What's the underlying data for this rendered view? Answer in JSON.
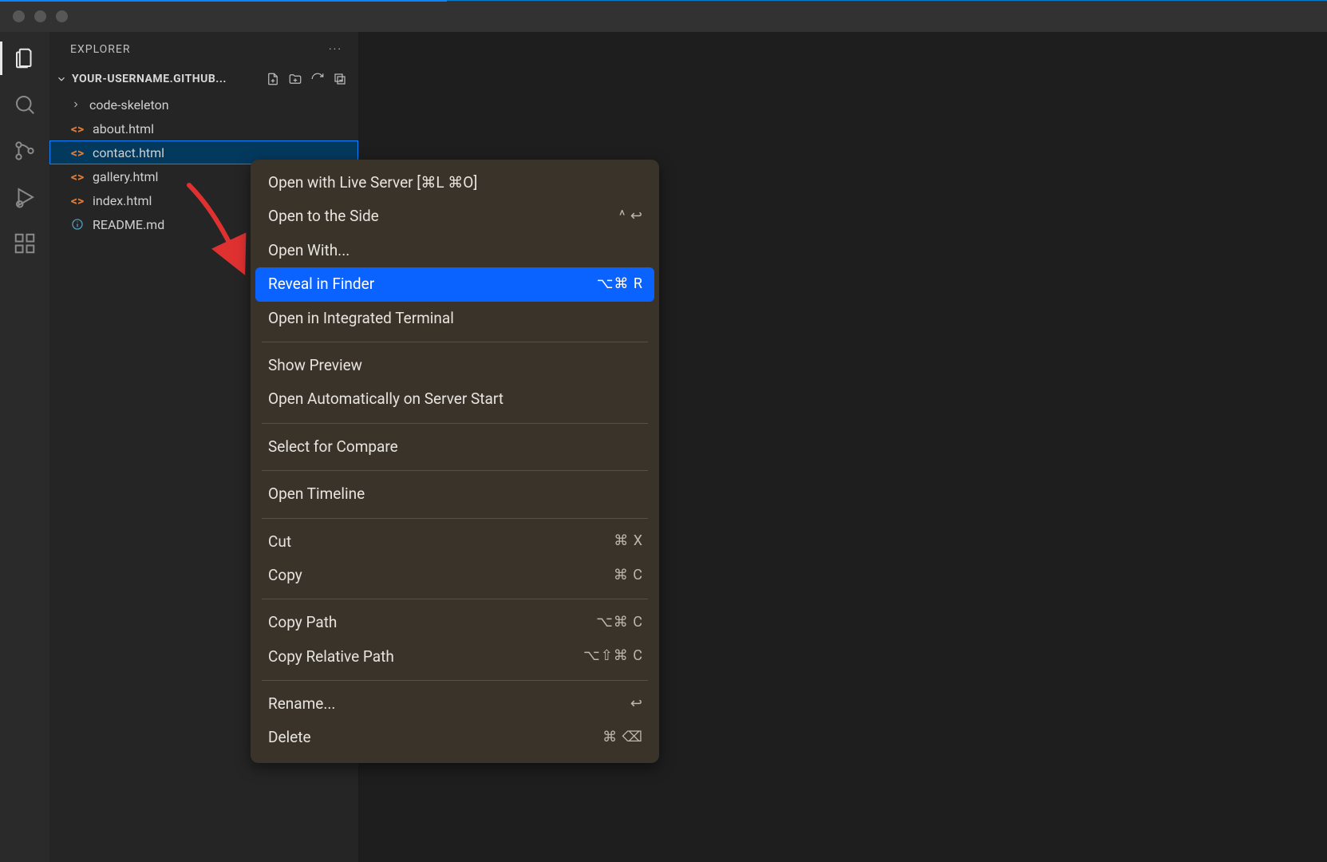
{
  "sidebar": {
    "title": "EXPLORER",
    "folder_name": "YOUR-USERNAME.GITHUB...",
    "items": [
      {
        "type": "folder",
        "name": "code-skeleton"
      },
      {
        "type": "file",
        "icon": "html",
        "name": "about.html"
      },
      {
        "type": "file",
        "icon": "html",
        "name": "contact.html",
        "selected": true
      },
      {
        "type": "file",
        "icon": "html",
        "name": "gallery.html"
      },
      {
        "type": "file",
        "icon": "html",
        "name": "index.html"
      },
      {
        "type": "file",
        "icon": "md",
        "name": "README.md"
      }
    ]
  },
  "context_menu": {
    "groups": [
      [
        {
          "label": "Open with Live Server [⌘L ⌘O]",
          "shortcut": ""
        },
        {
          "label": "Open to the Side",
          "shortcut": "^ ↩"
        },
        {
          "label": "Open With...",
          "shortcut": ""
        },
        {
          "label": "Reveal in Finder",
          "shortcut": "⌥⌘ R",
          "highlight": true
        },
        {
          "label": "Open in Integrated Terminal",
          "shortcut": ""
        }
      ],
      [
        {
          "label": "Show Preview",
          "shortcut": ""
        },
        {
          "label": "Open Automatically on Server Start",
          "shortcut": ""
        }
      ],
      [
        {
          "label": "Select for Compare",
          "shortcut": ""
        }
      ],
      [
        {
          "label": "Open Timeline",
          "shortcut": ""
        }
      ],
      [
        {
          "label": "Cut",
          "shortcut": "⌘ X"
        },
        {
          "label": "Copy",
          "shortcut": "⌘ C"
        }
      ],
      [
        {
          "label": "Copy Path",
          "shortcut": "⌥⌘ C"
        },
        {
          "label": "Copy Relative Path",
          "shortcut": "⌥⇧⌘ C"
        }
      ],
      [
        {
          "label": "Rename...",
          "shortcut": "↩"
        },
        {
          "label": "Delete",
          "shortcut": "⌘ ⌫"
        }
      ]
    ]
  }
}
